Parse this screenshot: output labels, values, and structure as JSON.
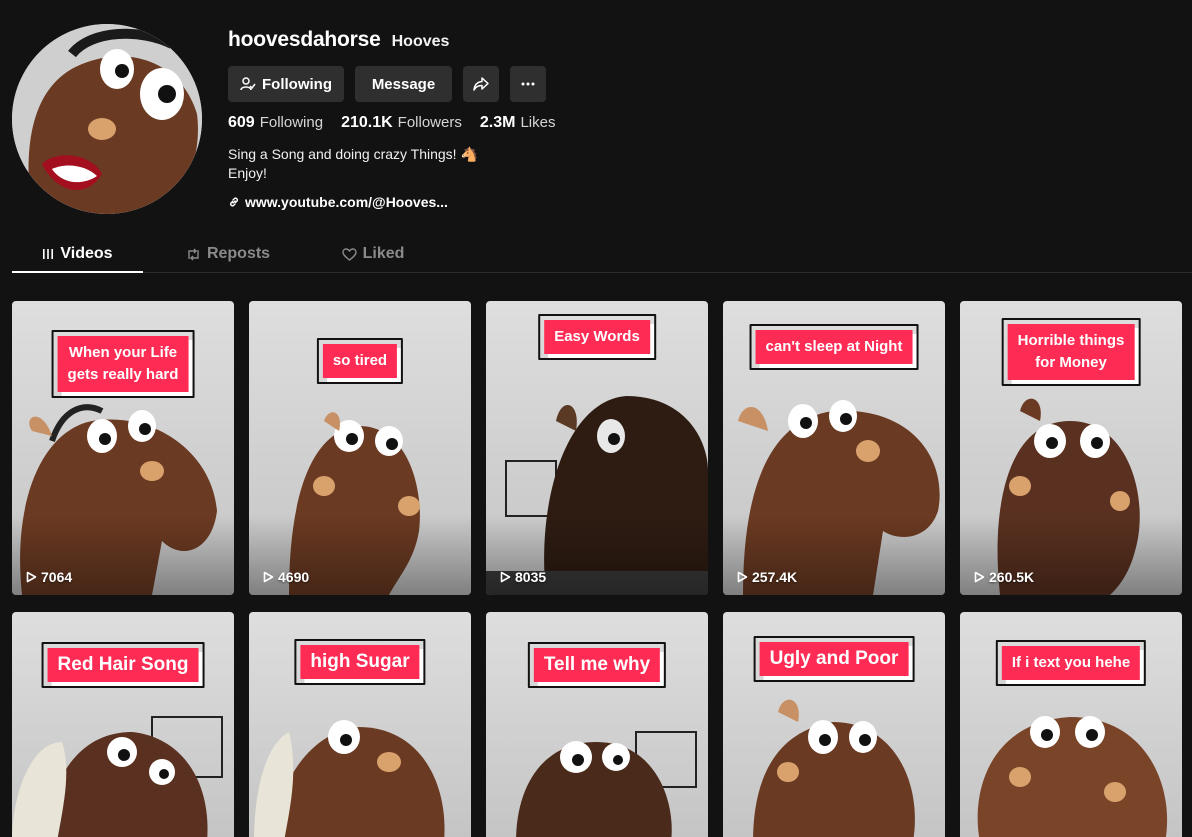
{
  "profile": {
    "username": "hoovesdahorse",
    "nickname": "Hooves",
    "following_button": "Following",
    "message_button": "Message",
    "stats": {
      "following_count": "609",
      "following_label": "Following",
      "followers_count": "210.1K",
      "followers_label": "Followers",
      "likes_count": "2.3M",
      "likes_label": "Likes"
    },
    "bio_line1": "Sing a Song and doing crazy Things! 🐴",
    "bio_line2": "Enjoy!",
    "link": "www.youtube.com/@Hooves..."
  },
  "tabs": {
    "videos": "Videos",
    "reposts": "Reposts",
    "liked": "Liked",
    "active": "Videos"
  },
  "videos": [
    {
      "caption": "When your Life gets really hard",
      "views": "7064"
    },
    {
      "caption": "so tired",
      "views": "4690"
    },
    {
      "caption": "Easy Words",
      "views": "8035"
    },
    {
      "caption": "can't sleep at Night",
      "views": "257.4K"
    },
    {
      "caption": "Horrible things for Money",
      "views": "260.5K"
    },
    {
      "caption": "Red Hair Song",
      "views": ""
    },
    {
      "caption": "high Sugar",
      "views": ""
    },
    {
      "caption": "Tell me why",
      "views": ""
    },
    {
      "caption": "Ugly and Poor",
      "views": ""
    },
    {
      "caption": "If i text you hehe",
      "views": ""
    }
  ],
  "colors": {
    "background": "#121212",
    "button": "#2f2f2f",
    "caption_accent": "#fe2c55",
    "puppet_brown": "#6b3a22"
  },
  "icons": [
    "person-check-icon",
    "share-icon",
    "more-icon",
    "link-icon",
    "grid-icon",
    "repost-icon",
    "liked-icon",
    "play-icon"
  ]
}
